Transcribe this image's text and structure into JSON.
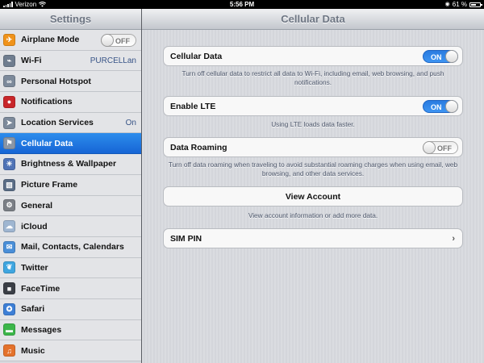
{
  "status_bar": {
    "carrier": "Verizon",
    "time": "5:56 PM",
    "battery_text": "61 %",
    "battery_level": 0.61
  },
  "sidebar": {
    "title": "Settings",
    "items": [
      {
        "label": "Airplane Mode",
        "icon": "airplane-icon",
        "color": "#f0931b",
        "toggle": "OFF"
      },
      {
        "label": "Wi-Fi",
        "icon": "wifi-icon",
        "color": "#6f7d8f",
        "value": "PURCELLan"
      },
      {
        "label": "Personal Hotspot",
        "icon": "hotspot-icon",
        "color": "#7d8a9b"
      },
      {
        "label": "Notifications",
        "icon": "notifications-icon",
        "color": "#c8262a"
      },
      {
        "label": "Location Services",
        "icon": "location-icon",
        "color": "#7d8a9b",
        "value": "On"
      },
      {
        "label": "Cellular Data",
        "icon": "cellular-icon",
        "color": "#8a96a6",
        "selected": true
      },
      {
        "label": "Brightness & Wallpaper",
        "icon": "brightness-icon",
        "color": "#4f73b6"
      },
      {
        "label": "Picture Frame",
        "icon": "picture-frame-icon",
        "color": "#5a6d86"
      },
      {
        "label": "General",
        "icon": "gear-icon",
        "color": "#7b7f86"
      },
      {
        "label": "iCloud",
        "icon": "icloud-icon",
        "color": "#9fb6d1"
      },
      {
        "label": "Mail, Contacts, Calendars",
        "icon": "mail-icon",
        "color": "#4a8fd8"
      },
      {
        "label": "Twitter",
        "icon": "twitter-icon",
        "color": "#3fa6e0"
      },
      {
        "label": "FaceTime",
        "icon": "facetime-icon",
        "color": "#3b3f46"
      },
      {
        "label": "Safari",
        "icon": "safari-icon",
        "color": "#3d7fd6"
      },
      {
        "label": "Messages",
        "icon": "messages-icon",
        "color": "#3cb64a"
      },
      {
        "label": "Music",
        "icon": "music-icon",
        "color": "#e4722c"
      }
    ]
  },
  "main": {
    "title": "Cellular Data",
    "cellular_data": {
      "label": "Cellular Data",
      "toggle": "ON",
      "footnote": "Turn off cellular data to restrict all data to Wi-Fi, including email, web browsing, and push notifications."
    },
    "enable_lte": {
      "label": "Enable LTE",
      "toggle": "ON",
      "footnote": "Using LTE loads data faster."
    },
    "data_roaming": {
      "label": "Data Roaming",
      "toggle": "OFF",
      "footnote": "Turn off data roaming when traveling to avoid substantial roaming charges when using email, web browsing, and other data services."
    },
    "view_account": {
      "label": "View Account",
      "footnote": "View account information or add more data."
    },
    "sim_pin": {
      "label": "SIM PIN"
    }
  }
}
